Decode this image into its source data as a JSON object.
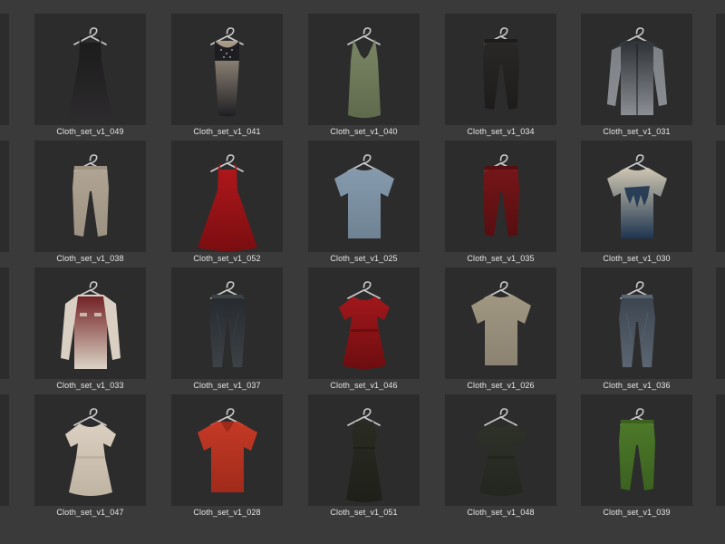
{
  "browser": {
    "rows": [
      [
        {
          "name": "Cloth_set_v1_049",
          "garment": "dress-slip",
          "color": "#1c1b1c",
          "accent": "#2c2a2c"
        },
        {
          "name": "Cloth_set_v1_041",
          "garment": "dress-long",
          "color": "#b3a491",
          "accent": "#1e1e22"
        },
        {
          "name": "Cloth_set_v1_040",
          "garment": "dress-v",
          "color": "#7d8a66",
          "accent": "#5f6a4d"
        },
        {
          "name": "Cloth_set_v1_034",
          "garment": "pants",
          "color": "#2a2826",
          "accent": "#1d1c1b"
        },
        {
          "name": "Cloth_set_v1_031",
          "garment": "shirt-long",
          "color": "#2e3136",
          "accent": "#8b8e93"
        }
      ],
      [
        {
          "name": "Cloth_set_v1_038",
          "garment": "pants",
          "color": "#b7ab9a",
          "accent": "#9d9282"
        },
        {
          "name": "Cloth_set_v1_052",
          "garment": "dress-full",
          "color": "#b3161a",
          "accent": "#7a0d10"
        },
        {
          "name": "Cloth_set_v1_025",
          "garment": "tshirt",
          "color": "#8aa0b3",
          "accent": "#6e8294"
        },
        {
          "name": "Cloth_set_v1_035",
          "garment": "pants",
          "color": "#7a1518",
          "accent": "#560e10"
        },
        {
          "name": "Cloth_set_v1_030",
          "garment": "tshirt-print",
          "color": "#d6cdb8",
          "accent": "#1e3550"
        }
      ],
      [
        {
          "name": "Cloth_set_v1_033",
          "garment": "shirt-vest",
          "color": "#6e1a1e",
          "accent": "#d9cfc2"
        },
        {
          "name": "Cloth_set_v1_037",
          "garment": "jeans",
          "color": "#26292d",
          "accent": "#3d4247"
        },
        {
          "name": "Cloth_set_v1_046",
          "garment": "dress-puff",
          "color": "#a7161a",
          "accent": "#6d0d10"
        },
        {
          "name": "Cloth_set_v1_026",
          "garment": "tshirt",
          "color": "#a69c86",
          "accent": "#8b8271"
        },
        {
          "name": "Cloth_set_v1_036",
          "garment": "jeans",
          "color": "#3c4550",
          "accent": "#5b6672"
        }
      ],
      [
        {
          "name": "Cloth_set_v1_047",
          "garment": "dress-puff",
          "color": "#e3d8c8",
          "accent": "#bfb3a2"
        },
        {
          "name": "Cloth_set_v1_028",
          "garment": "polo",
          "color": "#cc3a25",
          "accent": "#a02a1a"
        },
        {
          "name": "Cloth_set_v1_051",
          "garment": "dress-sleeveless",
          "color": "#2a2b22",
          "accent": "#1e1f18"
        },
        {
          "name": "Cloth_set_v1_048",
          "garment": "dress-puff",
          "color": "#2e3228",
          "accent": "#23261f"
        },
        {
          "name": "Cloth_set_v1_039",
          "garment": "pants",
          "color": "#4f7d2a",
          "accent": "#3b611f"
        }
      ]
    ]
  }
}
